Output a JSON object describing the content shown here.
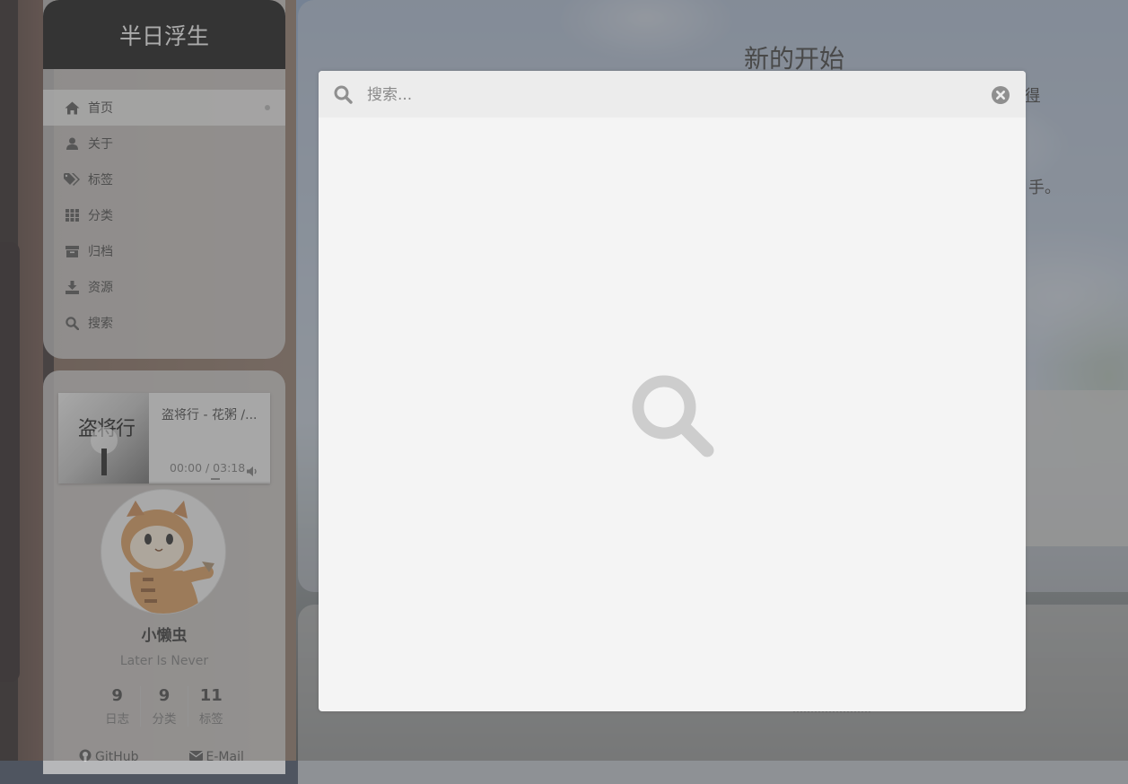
{
  "site": {
    "brand": "半日浮生"
  },
  "menu": [
    {
      "label": "首页",
      "icon": "home-icon",
      "active": true
    },
    {
      "label": "关于",
      "icon": "user-icon",
      "active": false
    },
    {
      "label": "标签",
      "icon": "tags-icon",
      "active": false
    },
    {
      "label": "分类",
      "icon": "grid-icon",
      "active": false
    },
    {
      "label": "归档",
      "icon": "archive-icon",
      "active": false
    },
    {
      "label": "资源",
      "icon": "download-icon",
      "active": false
    },
    {
      "label": "搜索",
      "icon": "search-icon",
      "active": false
    }
  ],
  "player": {
    "cover_text": "盗将行",
    "title": "盗将行 - 花粥 /...",
    "time": "00:00 / 03:18",
    "progress": 0
  },
  "author": {
    "name": "小懒虫",
    "motto": "Later Is Never",
    "stats": [
      {
        "count": "9",
        "label": "日志"
      },
      {
        "count": "9",
        "label": "分类"
      },
      {
        "count": "11",
        "label": "标签"
      }
    ],
    "links": [
      {
        "label": "GitHub",
        "icon": "github-icon"
      },
      {
        "label": "E-Mail",
        "icon": "envelope-icon"
      }
    ]
  },
  "post": {
    "title": "新的开始",
    "partial_text_1": "得",
    "partial_text_2": "手。"
  },
  "search": {
    "placeholder": "搜索...",
    "value": ""
  },
  "colors": {
    "sidebar_header": "#141414",
    "modal_bg": "#f4f4f4",
    "modal_header": "#ececec",
    "icon_gray": "#9a9a9a"
  }
}
